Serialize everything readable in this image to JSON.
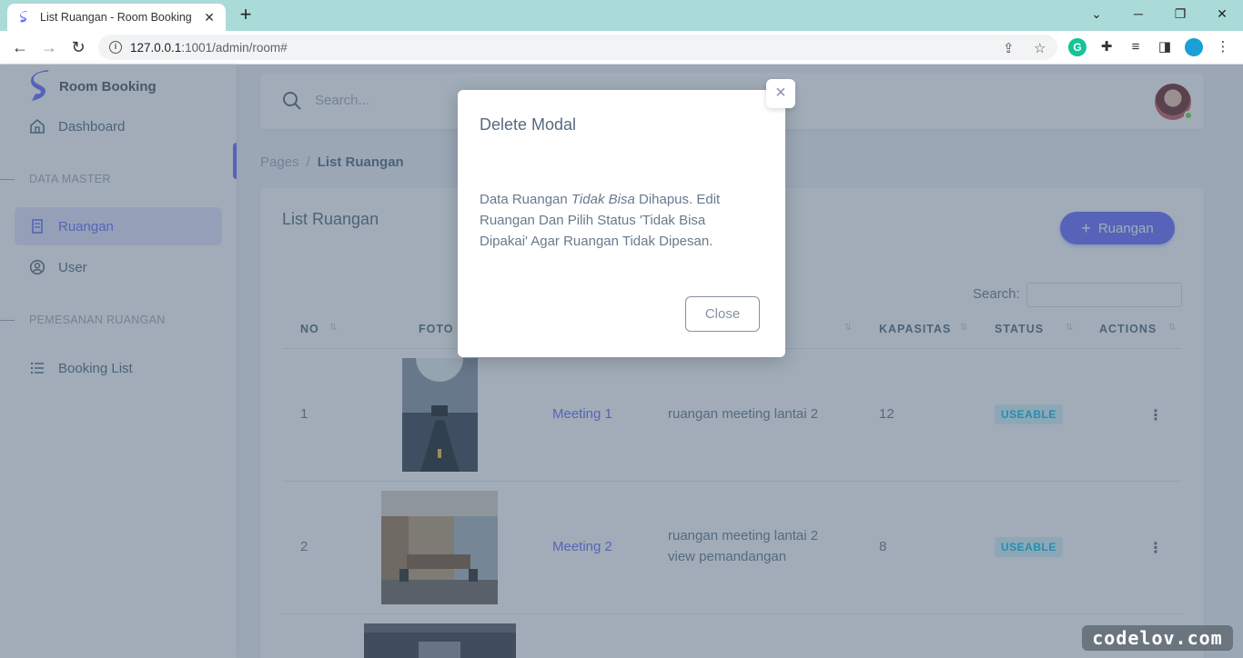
{
  "browser": {
    "tab_title": "List Ruangan - Room Booking",
    "url_host": "127.0.0.1",
    "url_rest": ":1001/admin/room#"
  },
  "sidebar": {
    "brand": "Room Booking",
    "dashboard": "Dashboard",
    "header_master": "DATA MASTER",
    "ruangan": "Ruangan",
    "user": "User",
    "header_pemesanan": "PEMESANAN RUANGAN",
    "booking_list": "Booking List"
  },
  "topnav": {
    "search_placeholder": "Search..."
  },
  "breadcrumb": {
    "parent": "Pages",
    "separator": "/",
    "current": "List Ruangan"
  },
  "card": {
    "title": "List Ruangan",
    "add_button": "Ruangan",
    "search_label": "Search:",
    "columns": [
      "NO",
      "FOTO",
      "KAPASITAS",
      "STATUS",
      "ACTIONS"
    ],
    "rows": [
      {
        "no": "1",
        "name": "Meeting 1",
        "desc_line1": "ruangan meeting lantai 2",
        "desc_line2": "",
        "capacity": "12",
        "status": "USEABLE"
      },
      {
        "no": "2",
        "name": "Meeting 2",
        "desc_line1": "ruangan meeting lantai 2",
        "desc_line2": "view pemandangan",
        "capacity": "8",
        "status": "USEABLE"
      }
    ]
  },
  "modal": {
    "title": "Delete Modal",
    "body_part1": "Data Ruangan ",
    "body_em": "Tidak Bisa",
    "body_part2": " Dihapus. Edit Ruangan Dan Pilih Status 'Tidak Bisa Dipakai' Agar Ruangan Tidak Dipesan.",
    "close_x": "×",
    "close_button": "Close"
  },
  "watermark": "codelov.com",
  "colors": {
    "primary": "#696cff",
    "info": "#03c3ec",
    "tabbar": "#aadbd8"
  }
}
